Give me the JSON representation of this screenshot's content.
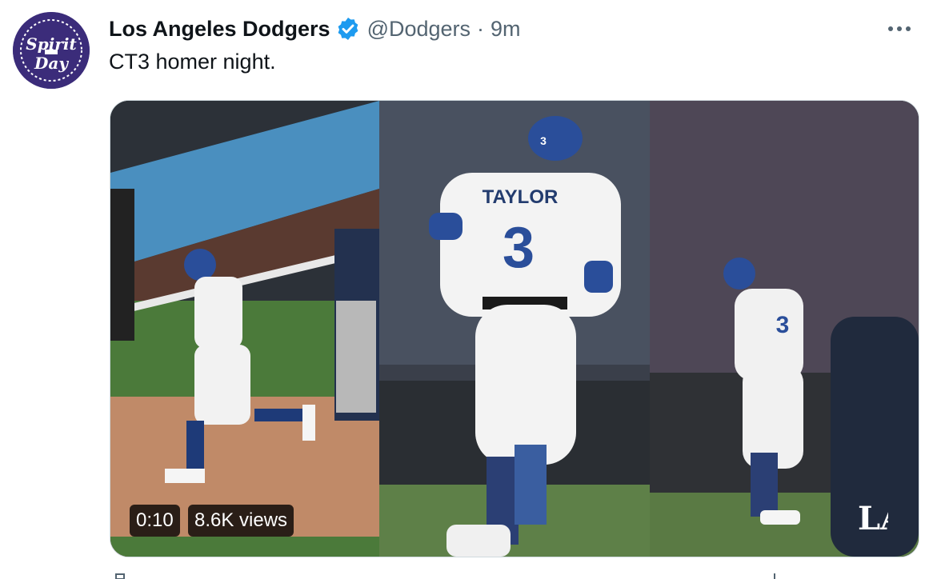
{
  "avatar": {
    "line1": "Spirit",
    "line2": "Day"
  },
  "tweet": {
    "display_name": "Los Angeles Dodgers",
    "handle": "@Dodgers",
    "separator": "·",
    "time": "9m",
    "text": "CT3 homer night."
  },
  "media": {
    "duration": "0:10",
    "views": "8.6K views",
    "jersey_name": "TAYLOR",
    "jersey_number": "3",
    "helmet_number": "3",
    "logo": "LA"
  },
  "colors": {
    "verified": "#1d9bf0",
    "avatar_bg": "#3b2c7a",
    "dodger_blue": "#2a4e9a",
    "grass": "#4b7a3a",
    "dirt": "#c08a68"
  },
  "icons": [
    "verified-badge-icon",
    "more-options-icon",
    "reply-icon",
    "share-icon"
  ]
}
